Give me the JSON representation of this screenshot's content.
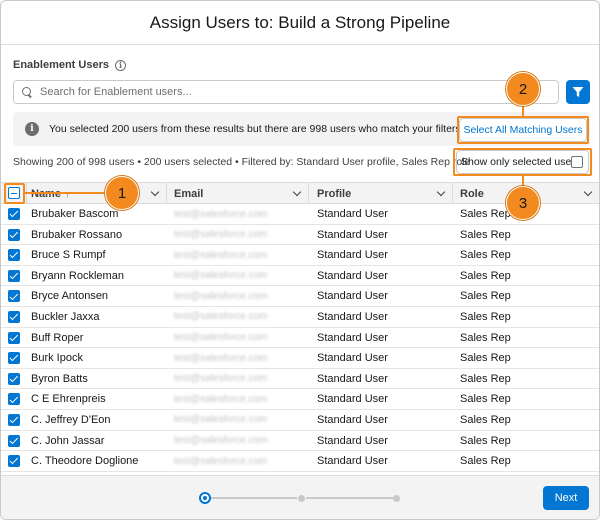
{
  "modal": {
    "title": "Assign Users to: Build a Strong Pipeline"
  },
  "field": {
    "label": "Enablement Users",
    "info_icon": "info-icon"
  },
  "search": {
    "placeholder": "Search for Enablement users...",
    "value": "",
    "filter_icon": "filter-icon"
  },
  "banner": {
    "text": "You selected 200 users from these results but there are 998 users who match your filters.",
    "select_all_label": "Select All Matching Users"
  },
  "status": {
    "text": "Showing 200 of 998 users • 200 users selected • Filtered by: Standard User profile, Sales Rep role",
    "show_only_label": "Show only selected users"
  },
  "table": {
    "columns": [
      {
        "label": "Name",
        "sort": "↑"
      },
      {
        "label": "Email"
      },
      {
        "label": "Profile"
      },
      {
        "label": "Role"
      }
    ],
    "rows": [
      {
        "name": "Brubaker Bascom",
        "email": "test@salesforce.com",
        "profile": "Standard User",
        "role": "Sales Rep"
      },
      {
        "name": "Brubaker Rossano",
        "email": "test@salesforce.com",
        "profile": "Standard User",
        "role": "Sales Rep"
      },
      {
        "name": "Bruce S Rumpf",
        "email": "test@salesforce.com",
        "profile": "Standard User",
        "role": "Sales Rep"
      },
      {
        "name": "Bryann Rockleman",
        "email": "test@salesforce.com",
        "profile": "Standard User",
        "role": "Sales Rep"
      },
      {
        "name": "Bryce Antonsen",
        "email": "test@salesforce.com",
        "profile": "Standard User",
        "role": "Sales Rep"
      },
      {
        "name": "Buckler Jaxxa",
        "email": "test@salesforce.com",
        "profile": "Standard User",
        "role": "Sales Rep"
      },
      {
        "name": "Buff Roper",
        "email": "test@salesforce.com",
        "profile": "Standard User",
        "role": "Sales Rep"
      },
      {
        "name": "Burk Ipock",
        "email": "test@salesforce.com",
        "profile": "Standard User",
        "role": "Sales Rep"
      },
      {
        "name": "Byron Batts",
        "email": "test@salesforce.com",
        "profile": "Standard User",
        "role": "Sales Rep"
      },
      {
        "name": "C E Ehrenpreis",
        "email": "test@salesforce.com",
        "profile": "Standard User",
        "role": "Sales Rep"
      },
      {
        "name": "C. Jeffrey D'Eon",
        "email": "test@salesforce.com",
        "profile": "Standard User",
        "role": "Sales Rep"
      },
      {
        "name": "C. John Jassar",
        "email": "test@salesforce.com",
        "profile": "Standard User",
        "role": "Sales Rep"
      },
      {
        "name": "C. Theodore Doglione",
        "email": "test@salesforce.com",
        "profile": "Standard User",
        "role": "Sales Rep"
      }
    ]
  },
  "footer": {
    "next_label": "Next",
    "steps": 3,
    "current_step": 1
  },
  "callouts": [
    "1",
    "2",
    "3"
  ],
  "colors": {
    "brand": "#0176d3",
    "callout": "#f28a1f"
  }
}
